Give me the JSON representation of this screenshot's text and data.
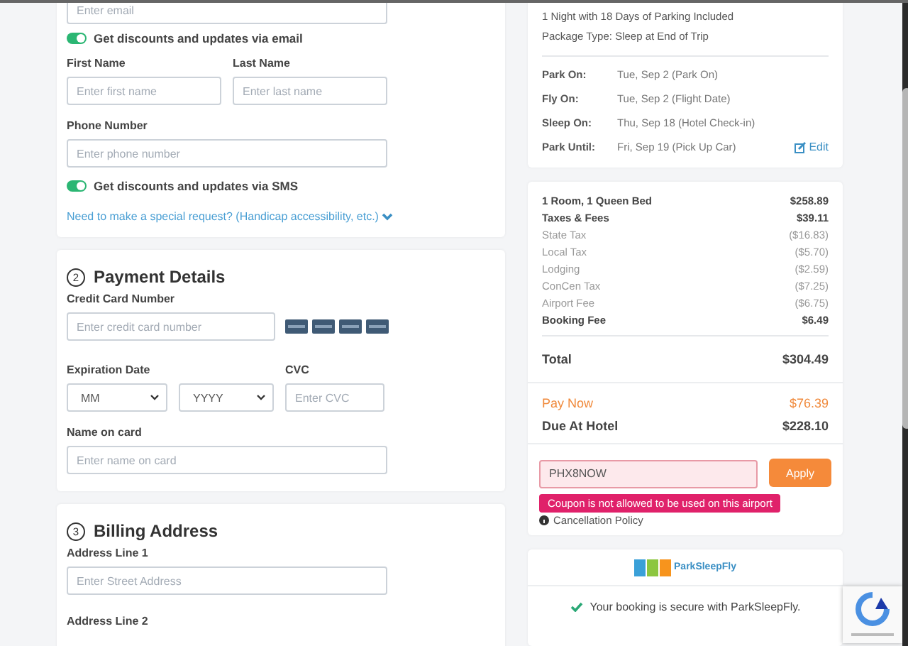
{
  "contact": {
    "email_field": {
      "placeholder": "Enter email"
    },
    "email_opt_in": {
      "label": "Get discounts and updates via email",
      "on": true
    },
    "first_name": {
      "label": "First Name",
      "placeholder": "Enter first name"
    },
    "last_name": {
      "label": "Last Name",
      "placeholder": "Enter last name"
    },
    "phone": {
      "label": "Phone Number",
      "placeholder": "Enter phone number"
    },
    "sms_opt_in": {
      "label": "Get discounts and updates via SMS",
      "on": true
    },
    "special_request_link": "Need to make a special request? (Handicap accessibility, etc.)"
  },
  "payment": {
    "step": "2",
    "title": "Payment Details",
    "card_number": {
      "label": "Credit Card Number",
      "placeholder": "Enter credit card number"
    },
    "expiration": {
      "label": "Expiration Date",
      "month": "MM",
      "year": "YYYY"
    },
    "cvc": {
      "label": "CVC",
      "placeholder": "Enter CVC"
    },
    "name_on_card": {
      "label": "Name on card",
      "placeholder": "Enter name on card"
    }
  },
  "billing": {
    "step": "3",
    "title": "Billing Address",
    "address_line_1": {
      "label": "Address Line 1",
      "placeholder": "Enter Street Address"
    },
    "address_line_2_label": "Address Line 2"
  },
  "summary": {
    "lines": [
      "1 Night with 18 Days of Parking Included",
      "Package Type: Sleep at End of Trip"
    ],
    "dates": [
      {
        "label": "Park On:",
        "value": "Tue, Sep 2 (Park On)"
      },
      {
        "label": "Fly On:",
        "value": "Tue, Sep 2 (Flight Date)"
      },
      {
        "label": "Sleep On:",
        "value": "Thu, Sep 18 (Hotel Check-in)"
      },
      {
        "label": "Park Until:",
        "value": "Fri, Sep 19 (Pick Up Car)"
      }
    ],
    "edit_link": "Edit"
  },
  "pricing": {
    "items": [
      {
        "label": "1 Room, 1 Queen Bed",
        "amount": "$258.89",
        "kind": "main"
      },
      {
        "label": "Taxes & Fees",
        "amount": "$39.11",
        "kind": "main"
      },
      {
        "label": "State Tax",
        "amount": "($16.83)",
        "kind": "sub"
      },
      {
        "label": "Local Tax",
        "amount": "($5.70)",
        "kind": "sub"
      },
      {
        "label": "Lodging",
        "amount": "($2.59)",
        "kind": "sub"
      },
      {
        "label": "ConCen Tax",
        "amount": "($7.25)",
        "kind": "sub"
      },
      {
        "label": "Airport Fee",
        "amount": "($6.75)",
        "kind": "sub"
      },
      {
        "label": "Booking Fee",
        "amount": "$6.49",
        "kind": "main"
      }
    ],
    "total": {
      "label": "Total",
      "amount": "$304.49"
    },
    "pay_now": {
      "label": "Pay Now",
      "amount": "$76.39"
    },
    "due_at_hotel": {
      "label": "Due At Hotel",
      "amount": "$228.10"
    }
  },
  "coupon": {
    "value": "PHX8NOW",
    "error": "Coupon is not allowed to be used on this airport",
    "button": "Apply"
  },
  "cancellation_link": "Cancellation Policy",
  "brand": {
    "name": "ParkSleepFly"
  },
  "secure_note": "Your booking is secure with ParkSleepFly."
}
